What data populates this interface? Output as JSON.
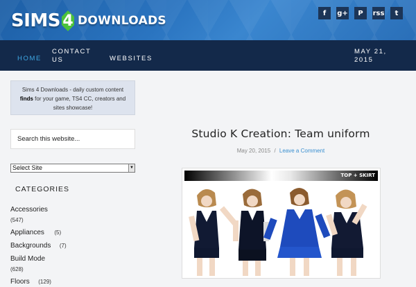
{
  "header": {
    "logo": {
      "sims": "SIMS",
      "four": "4",
      "downloads": "DOWNLOADS"
    },
    "social": [
      {
        "label": "f",
        "icon": "facebook-icon"
      },
      {
        "label": "g+",
        "icon": "google-plus-icon"
      },
      {
        "label": "P",
        "icon": "pinterest-icon"
      },
      {
        "label": "rss",
        "icon": "rss-icon"
      },
      {
        "label": "t",
        "icon": "twitter-icon"
      }
    ]
  },
  "nav": {
    "home": "HOME",
    "contact_1": "CONTACT",
    "contact_2": "US",
    "websites": "WEBSITES",
    "date_1": "MAY 21,",
    "date_2": "2015"
  },
  "sidebar": {
    "notice_pre": "Sims 4 Downloads - daily custom content",
    "notice_bold": "finds",
    "notice_post": "for your game, TS4 CC, creators and sites showcase!",
    "search_placeholder": "Search this website...",
    "select_label": "Select Site",
    "categories_title": "CATEGORIES",
    "categories": [
      {
        "name": "Accessories",
        "count": "(547)"
      },
      {
        "name": "Appliances",
        "count": "(5)"
      },
      {
        "name": "Backgrounds",
        "count": "(7)"
      },
      {
        "name": "Build Mode",
        "count": "(628)"
      },
      {
        "name": "Floors",
        "count": "(129)"
      }
    ]
  },
  "post": {
    "title": "Studio K Creation: Team uniform",
    "date": "May 20, 2015",
    "separator": "/",
    "comment_link": "Leave a Comment",
    "image_caption": "TOP + SKIRT"
  },
  "colors": {
    "header_blue": "#2a74c0",
    "nav_dark": "#13294a",
    "accent": "#3fa9e6",
    "logo_green": "#4cc23a"
  }
}
